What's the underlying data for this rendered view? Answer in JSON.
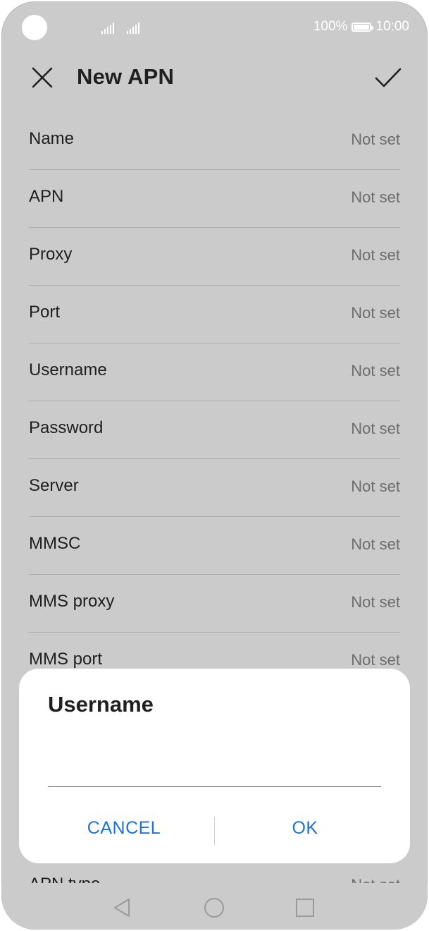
{
  "status_bar": {
    "battery_percent": "100%",
    "time": "10:00"
  },
  "app_bar": {
    "title": "New APN",
    "close_icon": "close-icon",
    "confirm_icon": "check-icon"
  },
  "fields": [
    {
      "label": "Name",
      "value": "Not set"
    },
    {
      "label": "APN",
      "value": "Not set"
    },
    {
      "label": "Proxy",
      "value": "Not set"
    },
    {
      "label": "Port",
      "value": "Not set"
    },
    {
      "label": "Username",
      "value": "Not set"
    },
    {
      "label": "Password",
      "value": "Not set"
    },
    {
      "label": "Server",
      "value": "Not set"
    },
    {
      "label": "MMSC",
      "value": "Not set"
    },
    {
      "label": "MMS proxy",
      "value": "Not set"
    },
    {
      "label": "MMS port",
      "value": "Not set"
    },
    {
      "label": "APN type",
      "value": "Not set"
    }
  ],
  "dialog": {
    "title": "Username",
    "input_value": "",
    "cancel_label": "CANCEL",
    "ok_label": "OK"
  },
  "nav_bar": {
    "back_icon": "back-triangle-icon",
    "home_icon": "home-circle-icon",
    "recents_icon": "recents-square-icon"
  },
  "colors": {
    "screen_background": "#cbcbcb",
    "dialog_background": "#ffffff",
    "accent": "#1a73d9",
    "primary_text": "#1f1f1f",
    "secondary_text": "#6d6d6d"
  }
}
